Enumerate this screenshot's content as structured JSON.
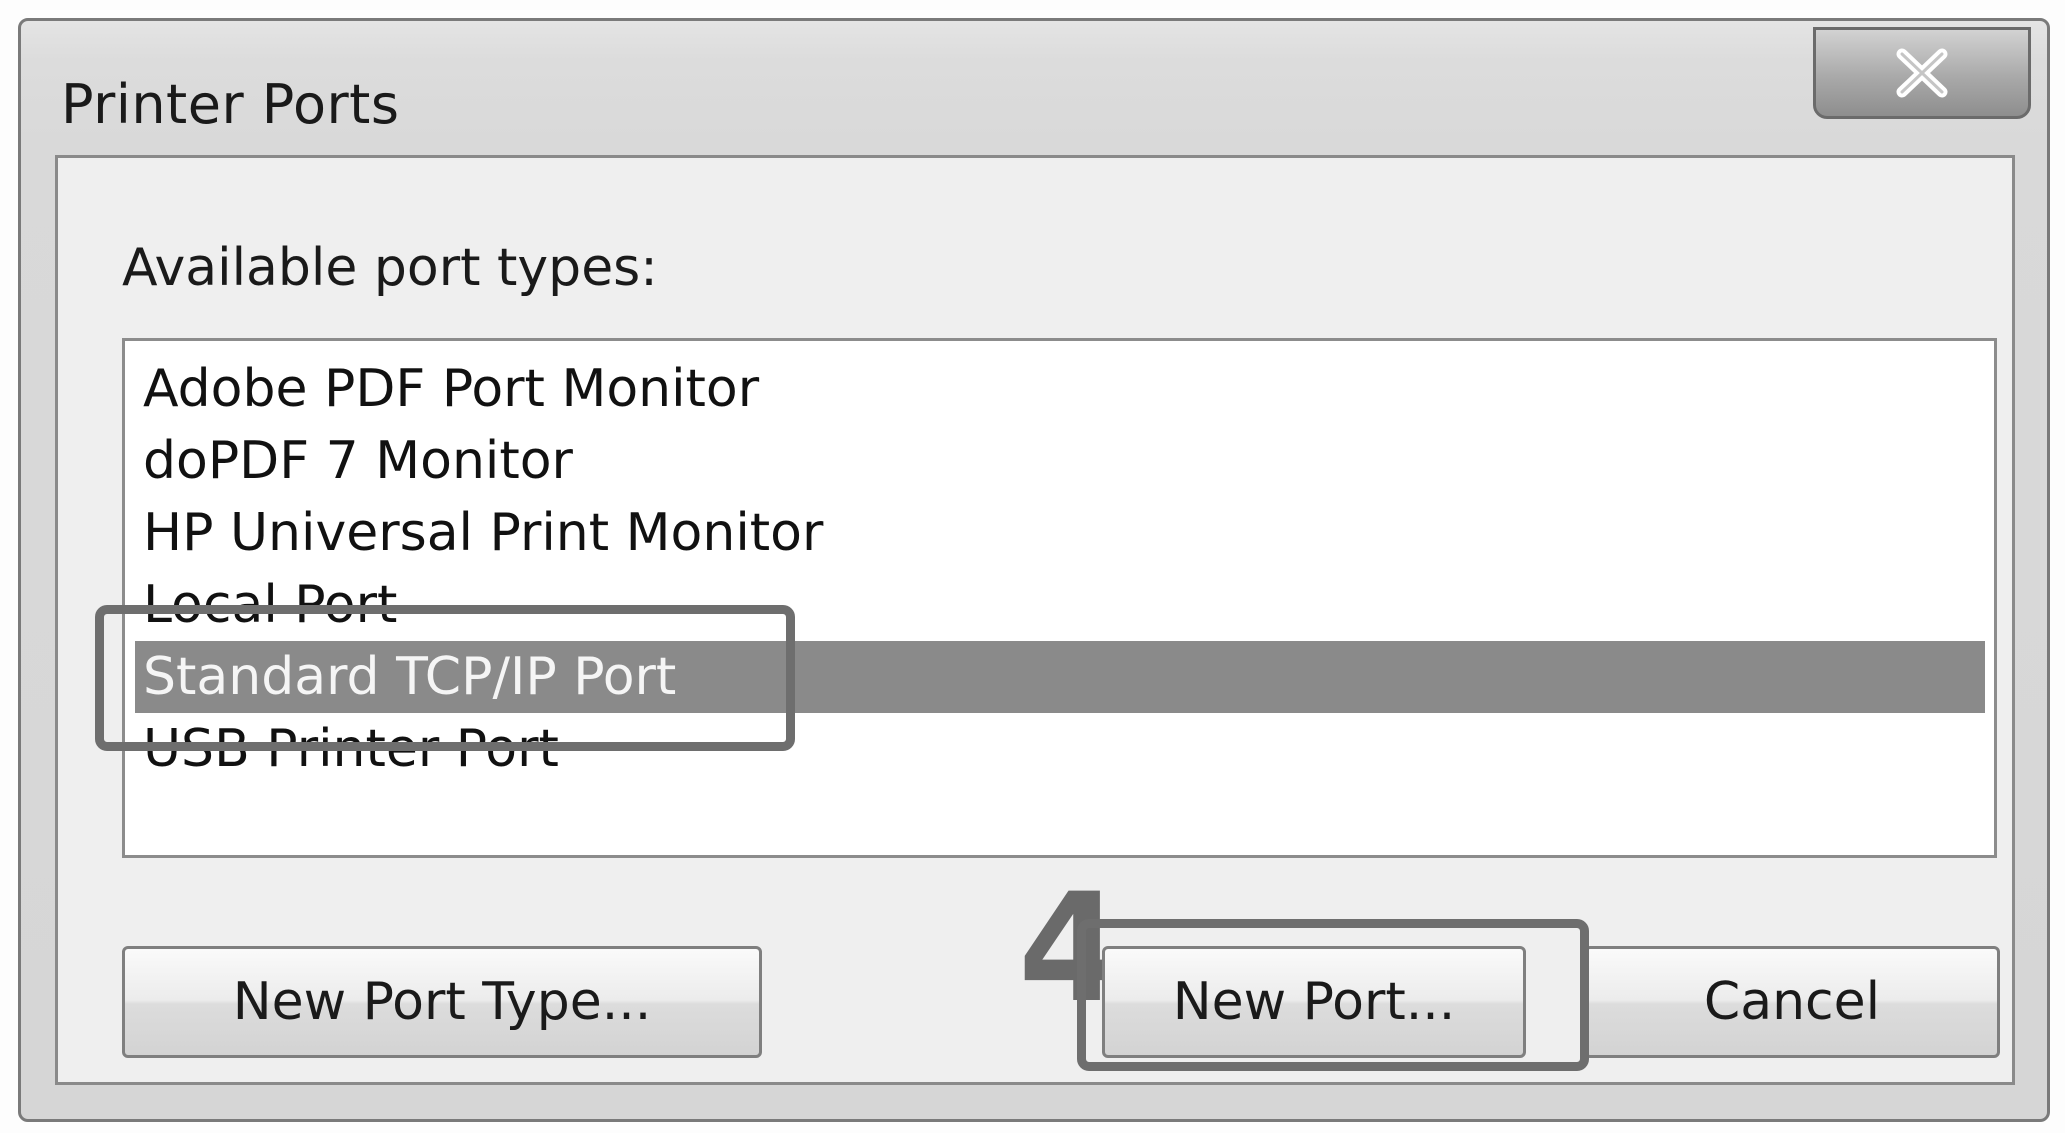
{
  "dialog": {
    "title": "Printer Ports",
    "close_icon": "close-icon"
  },
  "port_types": {
    "label": "Available port types:",
    "items": [
      {
        "label": "Adobe PDF Port Monitor",
        "selected": false
      },
      {
        "label": "doPDF 7 Monitor",
        "selected": false
      },
      {
        "label": "HP Universal Print Monitor",
        "selected": false
      },
      {
        "label": "Local Port",
        "selected": false
      },
      {
        "label": "Standard TCP/IP Port",
        "selected": true
      },
      {
        "label": "USB Printer Port",
        "selected": false
      }
    ]
  },
  "buttons": {
    "new_port_type": "New Port Type...",
    "new_port": "New Port...",
    "cancel": "Cancel"
  },
  "annotation": {
    "step_number": "4"
  },
  "colors": {
    "selection": "#8a8a8a",
    "callout": "#6e6e6e"
  }
}
